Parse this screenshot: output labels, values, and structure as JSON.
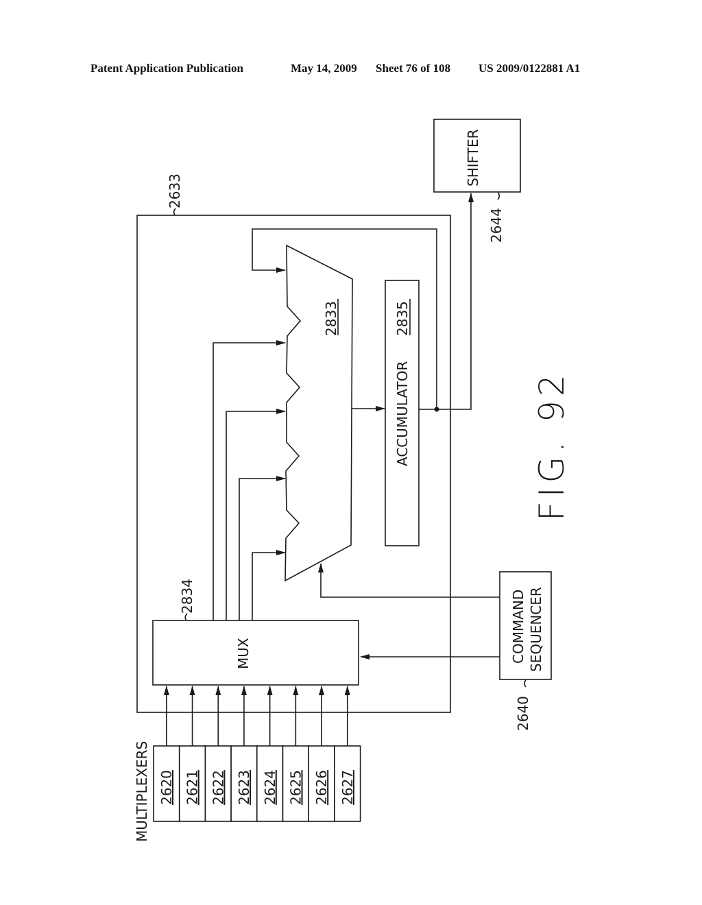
{
  "header": {
    "publication": "Patent Application Publication",
    "date": "May 14, 2009",
    "sheet": "Sheet 76 of 108",
    "number": "US 2009/0122881 A1"
  },
  "figure": {
    "caption": "FIG. 92",
    "blocks": {
      "shifter": {
        "label": "SHIFTER",
        "ref": "2644"
      },
      "outer_frame": {
        "ref": "2633"
      },
      "alu": {
        "ref": "2833"
      },
      "accumulator": {
        "label": "ACCUMULATOR",
        "ref": "2835"
      },
      "mux": {
        "label": "MUX",
        "ref": "2834"
      },
      "command_sequencer": {
        "label_line1": "COMMAND",
        "label_line2": "SEQUENCER",
        "ref": "2640"
      },
      "multiplexers": {
        "label": "MULTIPLEXERS",
        "items": [
          "2620",
          "2621",
          "2622",
          "2623",
          "2624",
          "2625",
          "2626",
          "2627"
        ]
      }
    }
  }
}
